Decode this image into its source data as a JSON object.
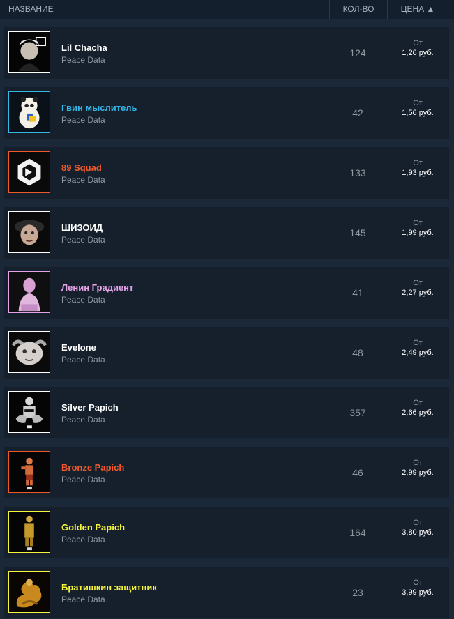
{
  "header": {
    "name_label": "НАЗВАНИЕ",
    "qty_label": "КОЛ-ВО",
    "price_label": "ЦЕНА ▲"
  },
  "rows": [
    {
      "title": "Lil Chacha",
      "title_color": "#ffffff",
      "frame_color": "#ffffff",
      "subtitle": "Peace Data",
      "qty": "124",
      "price_prefix": "От",
      "price": "1,26 руб.",
      "icon": "lil-chacha-avatar-icon"
    },
    {
      "title": "Гвин мыслитель",
      "title_color": "#35b7e8",
      "frame_color": "#35b7e8",
      "subtitle": "Peace Data",
      "qty": "42",
      "price_prefix": "От",
      "price": "1,56 руб.",
      "icon": "panda-thinker-icon"
    },
    {
      "title": "89 Squad",
      "title_color": "#f05a2a",
      "frame_color": "#f05a2a",
      "subtitle": "Peace Data",
      "qty": "133",
      "price_prefix": "От",
      "price": "1,93 руб.",
      "icon": "cube-logo-icon"
    },
    {
      "title": "ШИЗОИД",
      "title_color": "#ffffff",
      "frame_color": "#ffffff",
      "subtitle": "Peace Data",
      "qty": "145",
      "price_prefix": "От",
      "price": "1,99 руб.",
      "icon": "face-with-hat-icon"
    },
    {
      "title": "Ленин Градиент",
      "title_color": "#e4a2e8",
      "frame_color": "#e4a2e8",
      "subtitle": "Peace Data",
      "qty": "41",
      "price_prefix": "От",
      "price": "2,27 руб.",
      "icon": "lenin-bust-icon"
    },
    {
      "title": "Evelone",
      "title_color": "#ffffff",
      "frame_color": "#ffffff",
      "subtitle": "Peace Data",
      "qty": "48",
      "price_prefix": "От",
      "price": "2,49 руб.",
      "icon": "squished-face-icon"
    },
    {
      "title": "Silver Papich",
      "title_color": "#ffffff",
      "frame_color": "#ffffff",
      "subtitle": "Peace Data",
      "qty": "357",
      "price_prefix": "От",
      "price": "2,66 руб.",
      "icon": "silver-figure-icon"
    },
    {
      "title": "Bronze Papich",
      "title_color": "#f05a2a",
      "frame_color": "#f05a2a",
      "subtitle": "Peace Data",
      "qty": "46",
      "price_prefix": "От",
      "price": "2,99 руб.",
      "icon": "bronze-figure-icon"
    },
    {
      "title": "Golden Papich",
      "title_color": "#f6f53a",
      "frame_color": "#f6f53a",
      "subtitle": "Peace Data",
      "qty": "164",
      "price_prefix": "От",
      "price": "3,80 руб.",
      "icon": "golden-figure-icon"
    },
    {
      "title": "Братишкин защитник",
      "title_color": "#f6f53a",
      "frame_color": "#f6f53a",
      "subtitle": "Peace Data",
      "qty": "23",
      "price_prefix": "От",
      "price": "3,99 руб.",
      "icon": "dragon-warrior-icon"
    }
  ]
}
